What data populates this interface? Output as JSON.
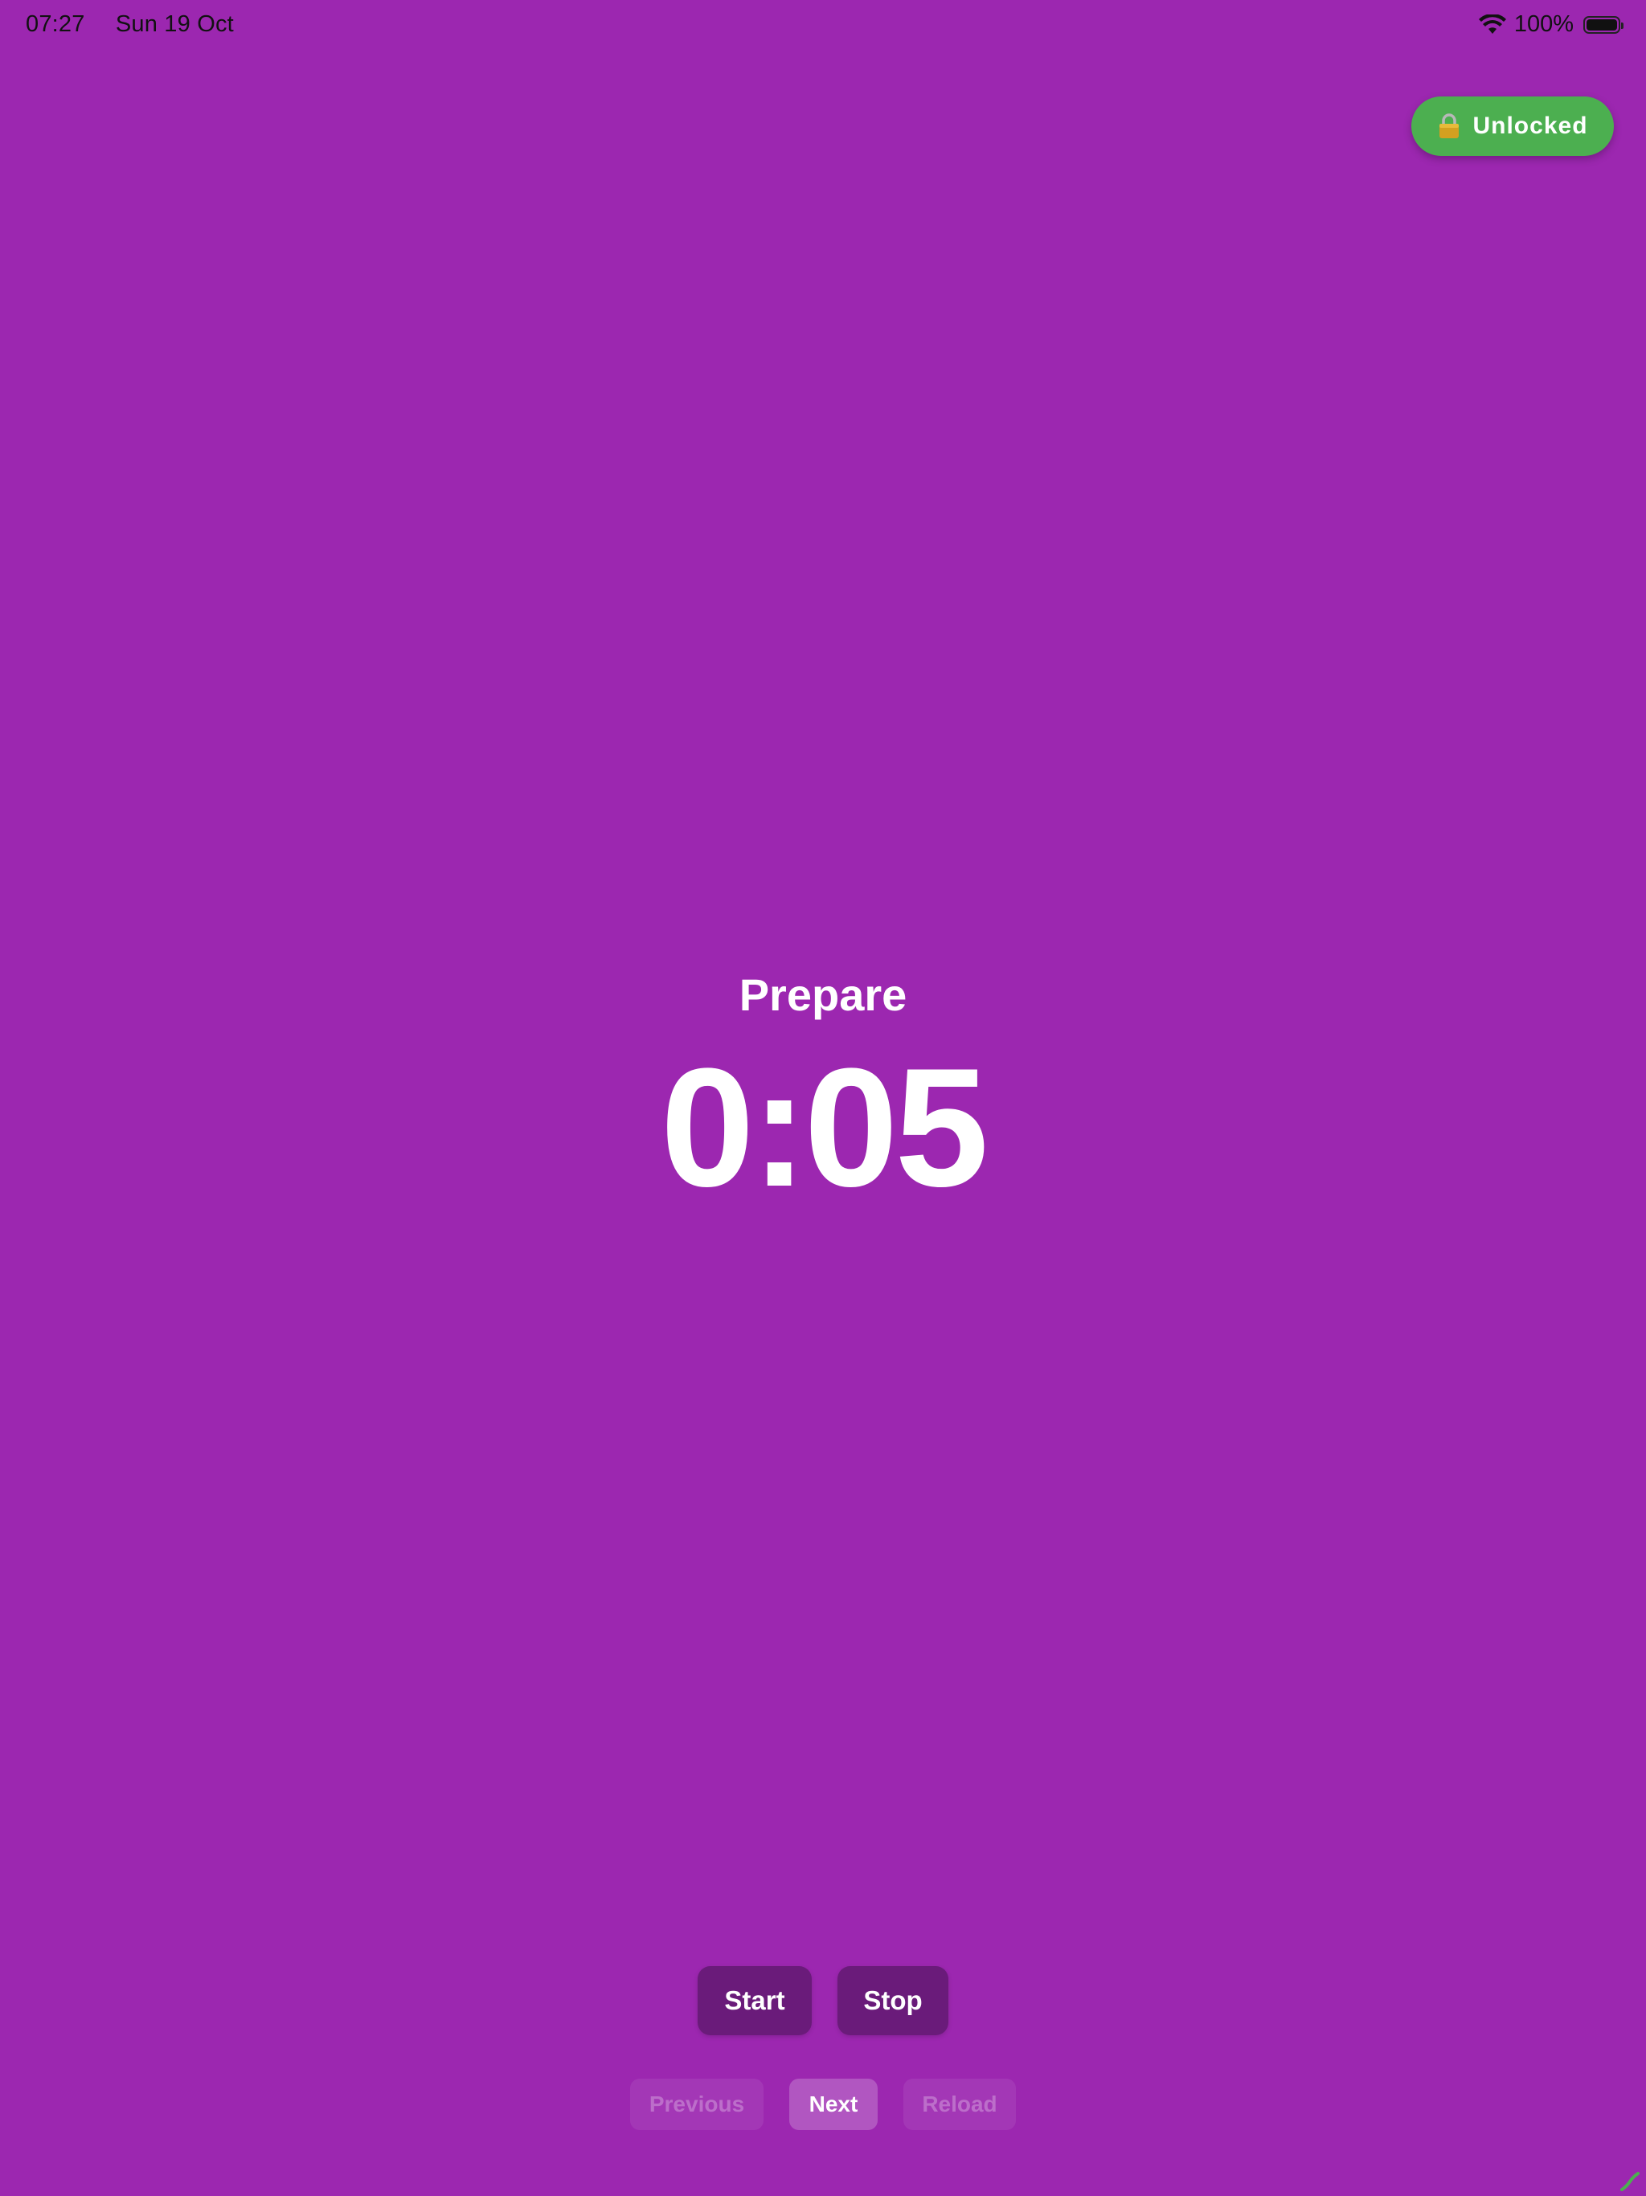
{
  "status_bar": {
    "time": "07:27",
    "date": "Sun 19 Oct",
    "battery": "100%"
  },
  "lock_status": {
    "label": "Unlocked",
    "color": "#4caf50",
    "icon": "lock-icon"
  },
  "timer": {
    "phase": "Prepare",
    "display": "0:05"
  },
  "controls": {
    "start_label": "Start",
    "stop_label": "Stop"
  },
  "navigation": {
    "previous_label": "Previous",
    "next_label": "Next",
    "reload_label": "Reload"
  },
  "theme": {
    "background": "#9c27b0",
    "button": "#6a1b7a"
  }
}
